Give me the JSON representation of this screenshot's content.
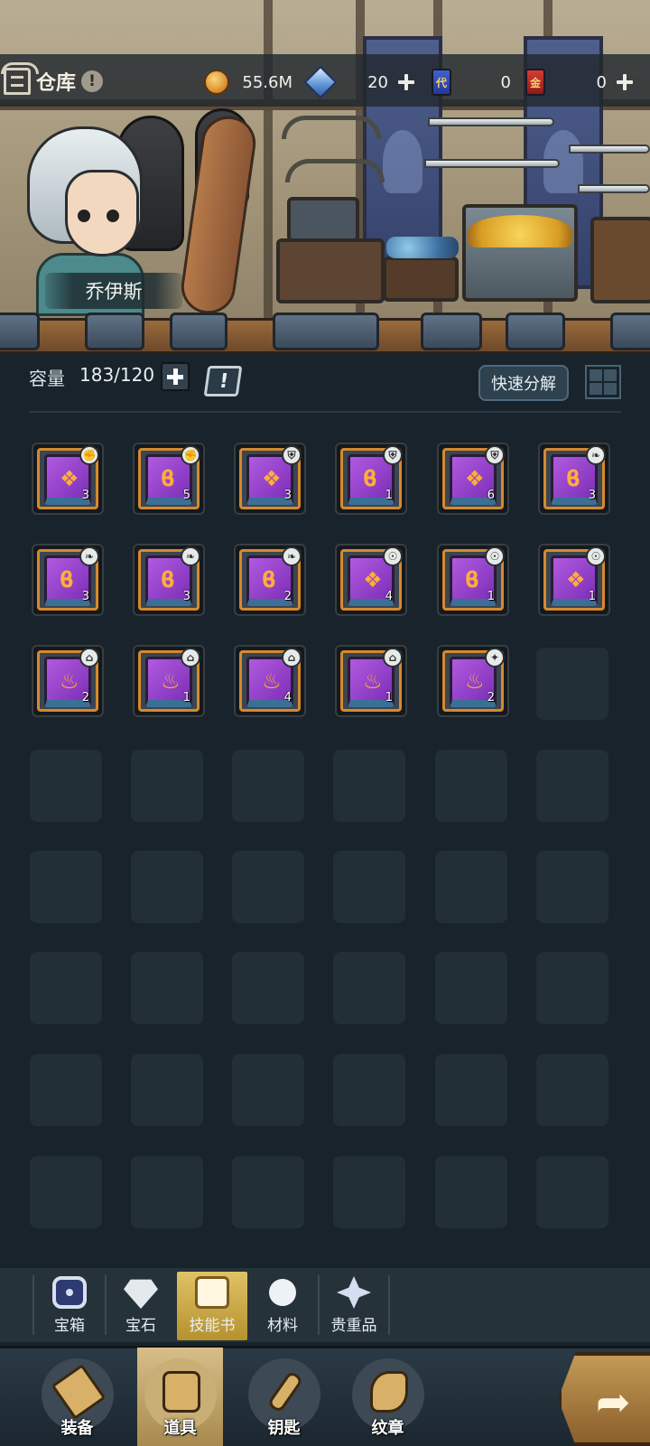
{
  "header": {
    "title": "仓库",
    "info_icon": "!",
    "resources": {
      "gold": {
        "icon": "gold-coin-icon",
        "value": "55.6M"
      },
      "diamond": {
        "icon": "diamond-icon",
        "value": "20"
      },
      "ticket_blue": {
        "icon": "blue-ticket-icon",
        "glyph": "代",
        "value": "0"
      },
      "ticket_red": {
        "icon": "red-ticket-icon",
        "glyph": "金",
        "value": "0"
      }
    }
  },
  "hero": {
    "name": "乔伊斯"
  },
  "capacity": {
    "label": "容量",
    "value": "183/120",
    "quest_glyph": "!"
  },
  "actions": {
    "quick_decompose": "快速分解"
  },
  "inventory": {
    "rows": [
      [
        {
          "count": "3",
          "emblem": "❖",
          "badge": "✊"
        },
        {
          "count": "5",
          "emblem": "ϐ",
          "badge": "✊"
        },
        {
          "count": "3",
          "emblem": "❖",
          "badge": "⛨"
        },
        {
          "count": "1",
          "emblem": "ϐ",
          "badge": "⛨"
        },
        {
          "count": "6",
          "emblem": "❖",
          "badge": "⛨"
        },
        {
          "count": "3",
          "emblem": "ϐ",
          "badge": "❧"
        }
      ],
      [
        {
          "count": "3",
          "emblem": "ϐ",
          "badge": "❧"
        },
        {
          "count": "3",
          "emblem": "ϐ",
          "badge": "❧"
        },
        {
          "count": "2",
          "emblem": "ϐ",
          "badge": "❧"
        },
        {
          "count": "4",
          "emblem": "❖",
          "badge": "☉"
        },
        {
          "count": "1",
          "emblem": "ϐ",
          "badge": "☉"
        },
        {
          "count": "1",
          "emblem": "❖",
          "badge": "☉"
        }
      ],
      [
        {
          "count": "2",
          "emblem": "♨",
          "badge": "⌂"
        },
        {
          "count": "1",
          "emblem": "♨",
          "badge": "⌂"
        },
        {
          "count": "4",
          "emblem": "♨",
          "badge": "⌂"
        },
        {
          "count": "1",
          "emblem": "♨",
          "badge": "⌂"
        },
        {
          "count": "2",
          "emblem": "♨",
          "badge": "✦"
        }
      ]
    ],
    "empty_slots_after": 1,
    "empty_rows": 5
  },
  "categories": [
    {
      "label": "宝箱",
      "icon": "chest-icon"
    },
    {
      "label": "宝石",
      "icon": "gem-icon"
    },
    {
      "label": "技能书",
      "icon": "skill-book-icon",
      "active": true
    },
    {
      "label": "材料",
      "icon": "material-icon"
    },
    {
      "label": "贵重品",
      "icon": "valuable-icon"
    }
  ],
  "nav": [
    {
      "label": "装备",
      "icon": "equipment-icon"
    },
    {
      "label": "道具",
      "icon": "items-icon",
      "active": true
    },
    {
      "label": "钥匙",
      "icon": "key-icon"
    },
    {
      "label": "纹章",
      "icon": "crest-icon"
    }
  ],
  "go_button_icon": "share-arrow-icon",
  "colors": {
    "background": "#18232b",
    "accent_gold": "#d6892e",
    "book_purple": "#9a45d0",
    "active_tab": "#d2b45a"
  }
}
